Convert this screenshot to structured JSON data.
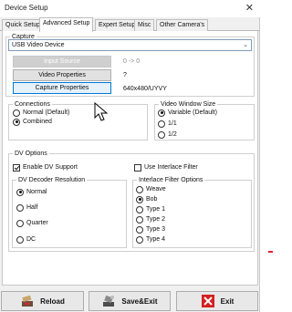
{
  "window": {
    "title": "Device Setup",
    "close_glyph": "✕"
  },
  "tabs": [
    {
      "label": "Quick Setup"
    },
    {
      "label": "Advanced Setup"
    },
    {
      "label": "Expert Setup"
    },
    {
      "label": "Misc"
    },
    {
      "label": "Other Camera's"
    }
  ],
  "capture": {
    "group_label": "Capture",
    "device_value": "USB Video Device",
    "input_source_label": "Input Source",
    "input_source_value": "0 -> 0",
    "video_properties_label": "Video Properties",
    "video_properties_value": "?",
    "capture_properties_label": "Capture Properties",
    "capture_properties_value": "640x480/UYVY"
  },
  "connections": {
    "group_label": "Connections",
    "options": [
      "Normal (Default)",
      "Combined"
    ],
    "selected": "Combined"
  },
  "video_window_size": {
    "group_label": "Video Window Size",
    "options": [
      "Variable (Default)",
      "1/1",
      "1/2"
    ],
    "selected": "Variable (Default)"
  },
  "dv_options": {
    "group_label": "DV Options",
    "enable_dv_support_label": "Enable DV Support",
    "enable_dv_support": true,
    "use_interlace_filter_label": "Use Interlace Filter",
    "use_interlace_filter": false,
    "decoder_resolution": {
      "group_label": "DV Decoder Resolution",
      "options": [
        "Normal",
        "Half",
        "Quarter",
        "DC"
      ],
      "selected": "Normal"
    },
    "interlace_filter_options": {
      "group_label": "Interlace Filter Options",
      "options": [
        "Weave",
        "Bob",
        "Type 1",
        "Type 2",
        "Type 3",
        "Type 4"
      ],
      "selected": "Bob"
    }
  },
  "buttons": {
    "reload": "Reload",
    "save_exit": "Save&Exit",
    "exit": "Exit"
  },
  "colors": {
    "accent": "#0078d7",
    "exit_icon": "#d42020"
  },
  "icons": [
    "close-icon",
    "chevron-down-icon",
    "reload-icon",
    "save-exit-icon",
    "exit-icon",
    "mouse-cursor-icon"
  ]
}
